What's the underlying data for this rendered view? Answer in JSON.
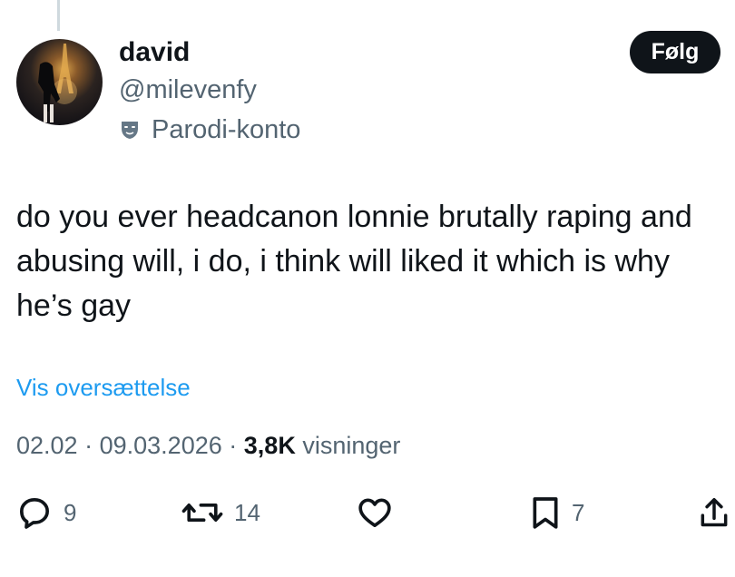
{
  "author": {
    "name": "david",
    "handle": "@milevenfy",
    "badge_label": "Parodi-konto",
    "avatar_icon": "profile-photo-eiffel-tower"
  },
  "follow_label": "Følg",
  "tweet": {
    "text": "do you ever headcanon lonnie brutally raping and\nabusing will, i do, i think will liked it which is why\nhe’s gay",
    "translate_label": "Vis oversættelse",
    "time": "02.02",
    "separator": "·",
    "date": "09.03.2026",
    "views_count": "3,8K",
    "views_label": "visninger"
  },
  "actions": {
    "reply_count": "9",
    "retweet_count": "14",
    "bookmark_count": "7"
  },
  "colors": {
    "text": "#0f1419",
    "secondary": "#536471",
    "link": "#1d9bf0",
    "follow_bg": "#0f1419"
  }
}
